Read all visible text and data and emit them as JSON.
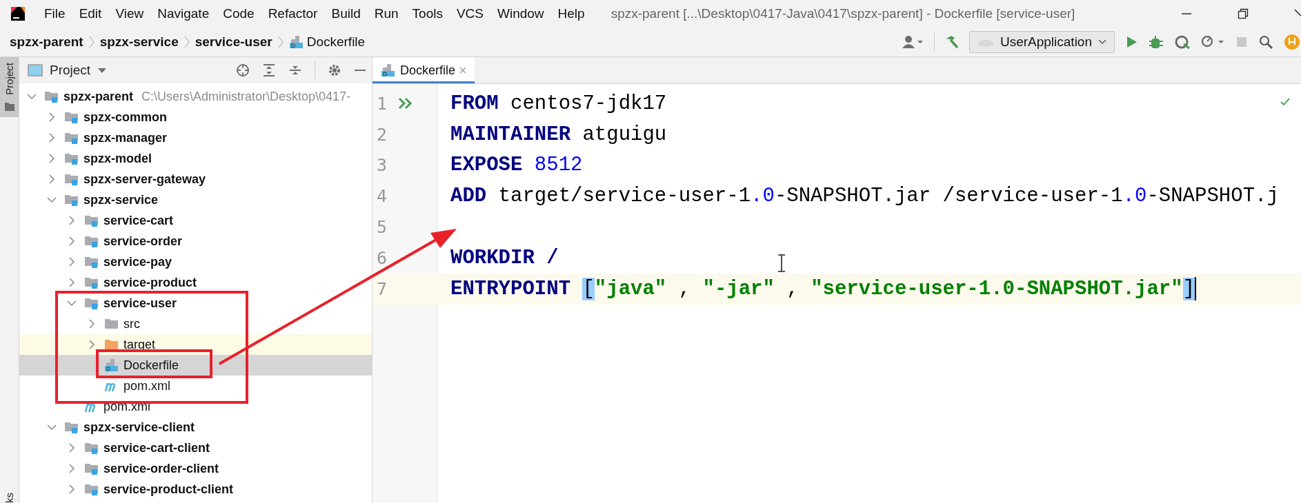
{
  "menu_bar": {
    "items": [
      "File",
      "Edit",
      "View",
      "Navigate",
      "Code",
      "Refactor",
      "Build",
      "Run",
      "Tools",
      "VCS",
      "Window",
      "Help"
    ],
    "title": "spzx-parent [...\\Desktop\\0417-Java\\0417\\spzx-parent] - Dockerfile [service-user]"
  },
  "breadcrumbs": [
    {
      "label": "spzx-parent",
      "kind": "module"
    },
    {
      "label": "spzx-service",
      "kind": "module"
    },
    {
      "label": "service-user",
      "kind": "module"
    },
    {
      "label": "Dockerfile",
      "kind": "dockerfile"
    }
  ],
  "toolbar": {
    "run_configuration": "UserApplication"
  },
  "side_stripe": {
    "tabs": [
      {
        "label": "Project",
        "selected": true
      }
    ],
    "bottom_tab": "ks"
  },
  "project_panel": {
    "title": "Project",
    "tree": [
      {
        "label": "spzx-parent",
        "kind": "module",
        "hint": "C:\\Users\\Administrator\\Desktop\\0417-",
        "expanded": true,
        "selected": false,
        "highlighted": false,
        "children": [
          {
            "label": "spzx-common",
            "kind": "module",
            "expanded": false,
            "selected": false,
            "highlighted": false
          },
          {
            "label": "spzx-manager",
            "kind": "module",
            "expanded": false,
            "selected": false,
            "highlighted": false
          },
          {
            "label": "spzx-model",
            "kind": "module",
            "expanded": false,
            "selected": false,
            "highlighted": false
          },
          {
            "label": "spzx-server-gateway",
            "kind": "module",
            "expanded": false,
            "selected": false,
            "highlighted": false
          },
          {
            "label": "spzx-service",
            "kind": "module",
            "expanded": true,
            "selected": false,
            "highlighted": false,
            "children": [
              {
                "label": "service-cart",
                "kind": "module",
                "expanded": false,
                "selected": false,
                "highlighted": false
              },
              {
                "label": "service-order",
                "kind": "module",
                "expanded": false,
                "selected": false,
                "highlighted": false
              },
              {
                "label": "service-pay",
                "kind": "module",
                "expanded": false,
                "selected": false,
                "highlighted": false
              },
              {
                "label": "service-product",
                "kind": "module",
                "expanded": false,
                "selected": false,
                "highlighted": false
              },
              {
                "label": "service-user",
                "kind": "module",
                "expanded": true,
                "selected": false,
                "highlighted": false,
                "children": [
                  {
                    "label": "src",
                    "kind": "folder",
                    "expanded": false,
                    "selected": false,
                    "highlighted": false
                  },
                  {
                    "label": "target",
                    "kind": "excluded-folder",
                    "expanded": false,
                    "selected": false,
                    "highlighted": true
                  },
                  {
                    "label": "Dockerfile",
                    "kind": "dockerfile",
                    "expanded": false,
                    "selected": true,
                    "highlighted": false
                  },
                  {
                    "label": "pom.xml",
                    "kind": "maven",
                    "expanded": false,
                    "selected": false,
                    "highlighted": false
                  }
                ]
              },
              {
                "label": "pom.xml",
                "kind": "maven",
                "expanded": false,
                "selected": false,
                "highlighted": false
              }
            ]
          },
          {
            "label": "spzx-service-client",
            "kind": "module",
            "expanded": true,
            "selected": false,
            "highlighted": false,
            "children": [
              {
                "label": "service-cart-client",
                "kind": "module",
                "expanded": false,
                "selected": false,
                "highlighted": false
              },
              {
                "label": "service-order-client",
                "kind": "module",
                "expanded": false,
                "selected": false,
                "highlighted": false
              },
              {
                "label": "service-product-client",
                "kind": "module",
                "expanded": false,
                "selected": false,
                "highlighted": false
              }
            ]
          }
        ]
      }
    ]
  },
  "editor": {
    "tabs": [
      {
        "label": "Dockerfile",
        "selected": true
      }
    ],
    "lines": [
      {
        "number": "1",
        "runnable": true,
        "current": false,
        "caret": false,
        "tokens": [
          {
            "text": "FROM",
            "kind": "keyword"
          },
          {
            "text": " centos7-jdk17",
            "kind": "plain"
          }
        ]
      },
      {
        "number": "2",
        "runnable": false,
        "current": false,
        "caret": false,
        "tokens": [
          {
            "text": "MAINTAINER",
            "kind": "keyword"
          },
          {
            "text": " atguigu",
            "kind": "plain"
          }
        ]
      },
      {
        "number": "3",
        "runnable": false,
        "current": false,
        "caret": false,
        "tokens": [
          {
            "text": "EXPOSE",
            "kind": "keyword"
          },
          {
            "text": " 8512",
            "kind": "number"
          }
        ]
      },
      {
        "number": "4",
        "runnable": false,
        "current": false,
        "caret": false,
        "tokens": [
          {
            "text": "ADD",
            "kind": "keyword"
          },
          {
            "text": " target/service-user-1",
            "kind": "plain"
          },
          {
            "text": ".0",
            "kind": "number"
          },
          {
            "text": "-SNAPSHOT.jar /service-user-1",
            "kind": "plain"
          },
          {
            "text": ".0",
            "kind": "number"
          },
          {
            "text": "-SNAPSHOT.j",
            "kind": "plain"
          }
        ]
      },
      {
        "number": "5",
        "runnable": false,
        "current": false,
        "caret": false
      },
      {
        "number": "6",
        "runnable": false,
        "current": false,
        "caret": false,
        "tokens": [
          {
            "text": "WORKDIR /",
            "kind": "keyword"
          }
        ]
      },
      {
        "number": "7",
        "runnable": false,
        "current": true,
        "caret": true,
        "tokens": [
          {
            "text": "ENTRYPOINT ",
            "kind": "keyword"
          },
          {
            "text": "[",
            "kind": "bracket"
          },
          {
            "text": "\"java\"",
            "kind": "string"
          },
          {
            "text": " , ",
            "kind": "plain"
          },
          {
            "text": "\"-jar\"",
            "kind": "string"
          },
          {
            "text": " , ",
            "kind": "plain"
          },
          {
            "text": "\"service-user-1.0-SNAPSHOT.jar\"",
            "kind": "string"
          },
          {
            "text": "]",
            "kind": "bracket"
          }
        ]
      }
    ]
  }
}
